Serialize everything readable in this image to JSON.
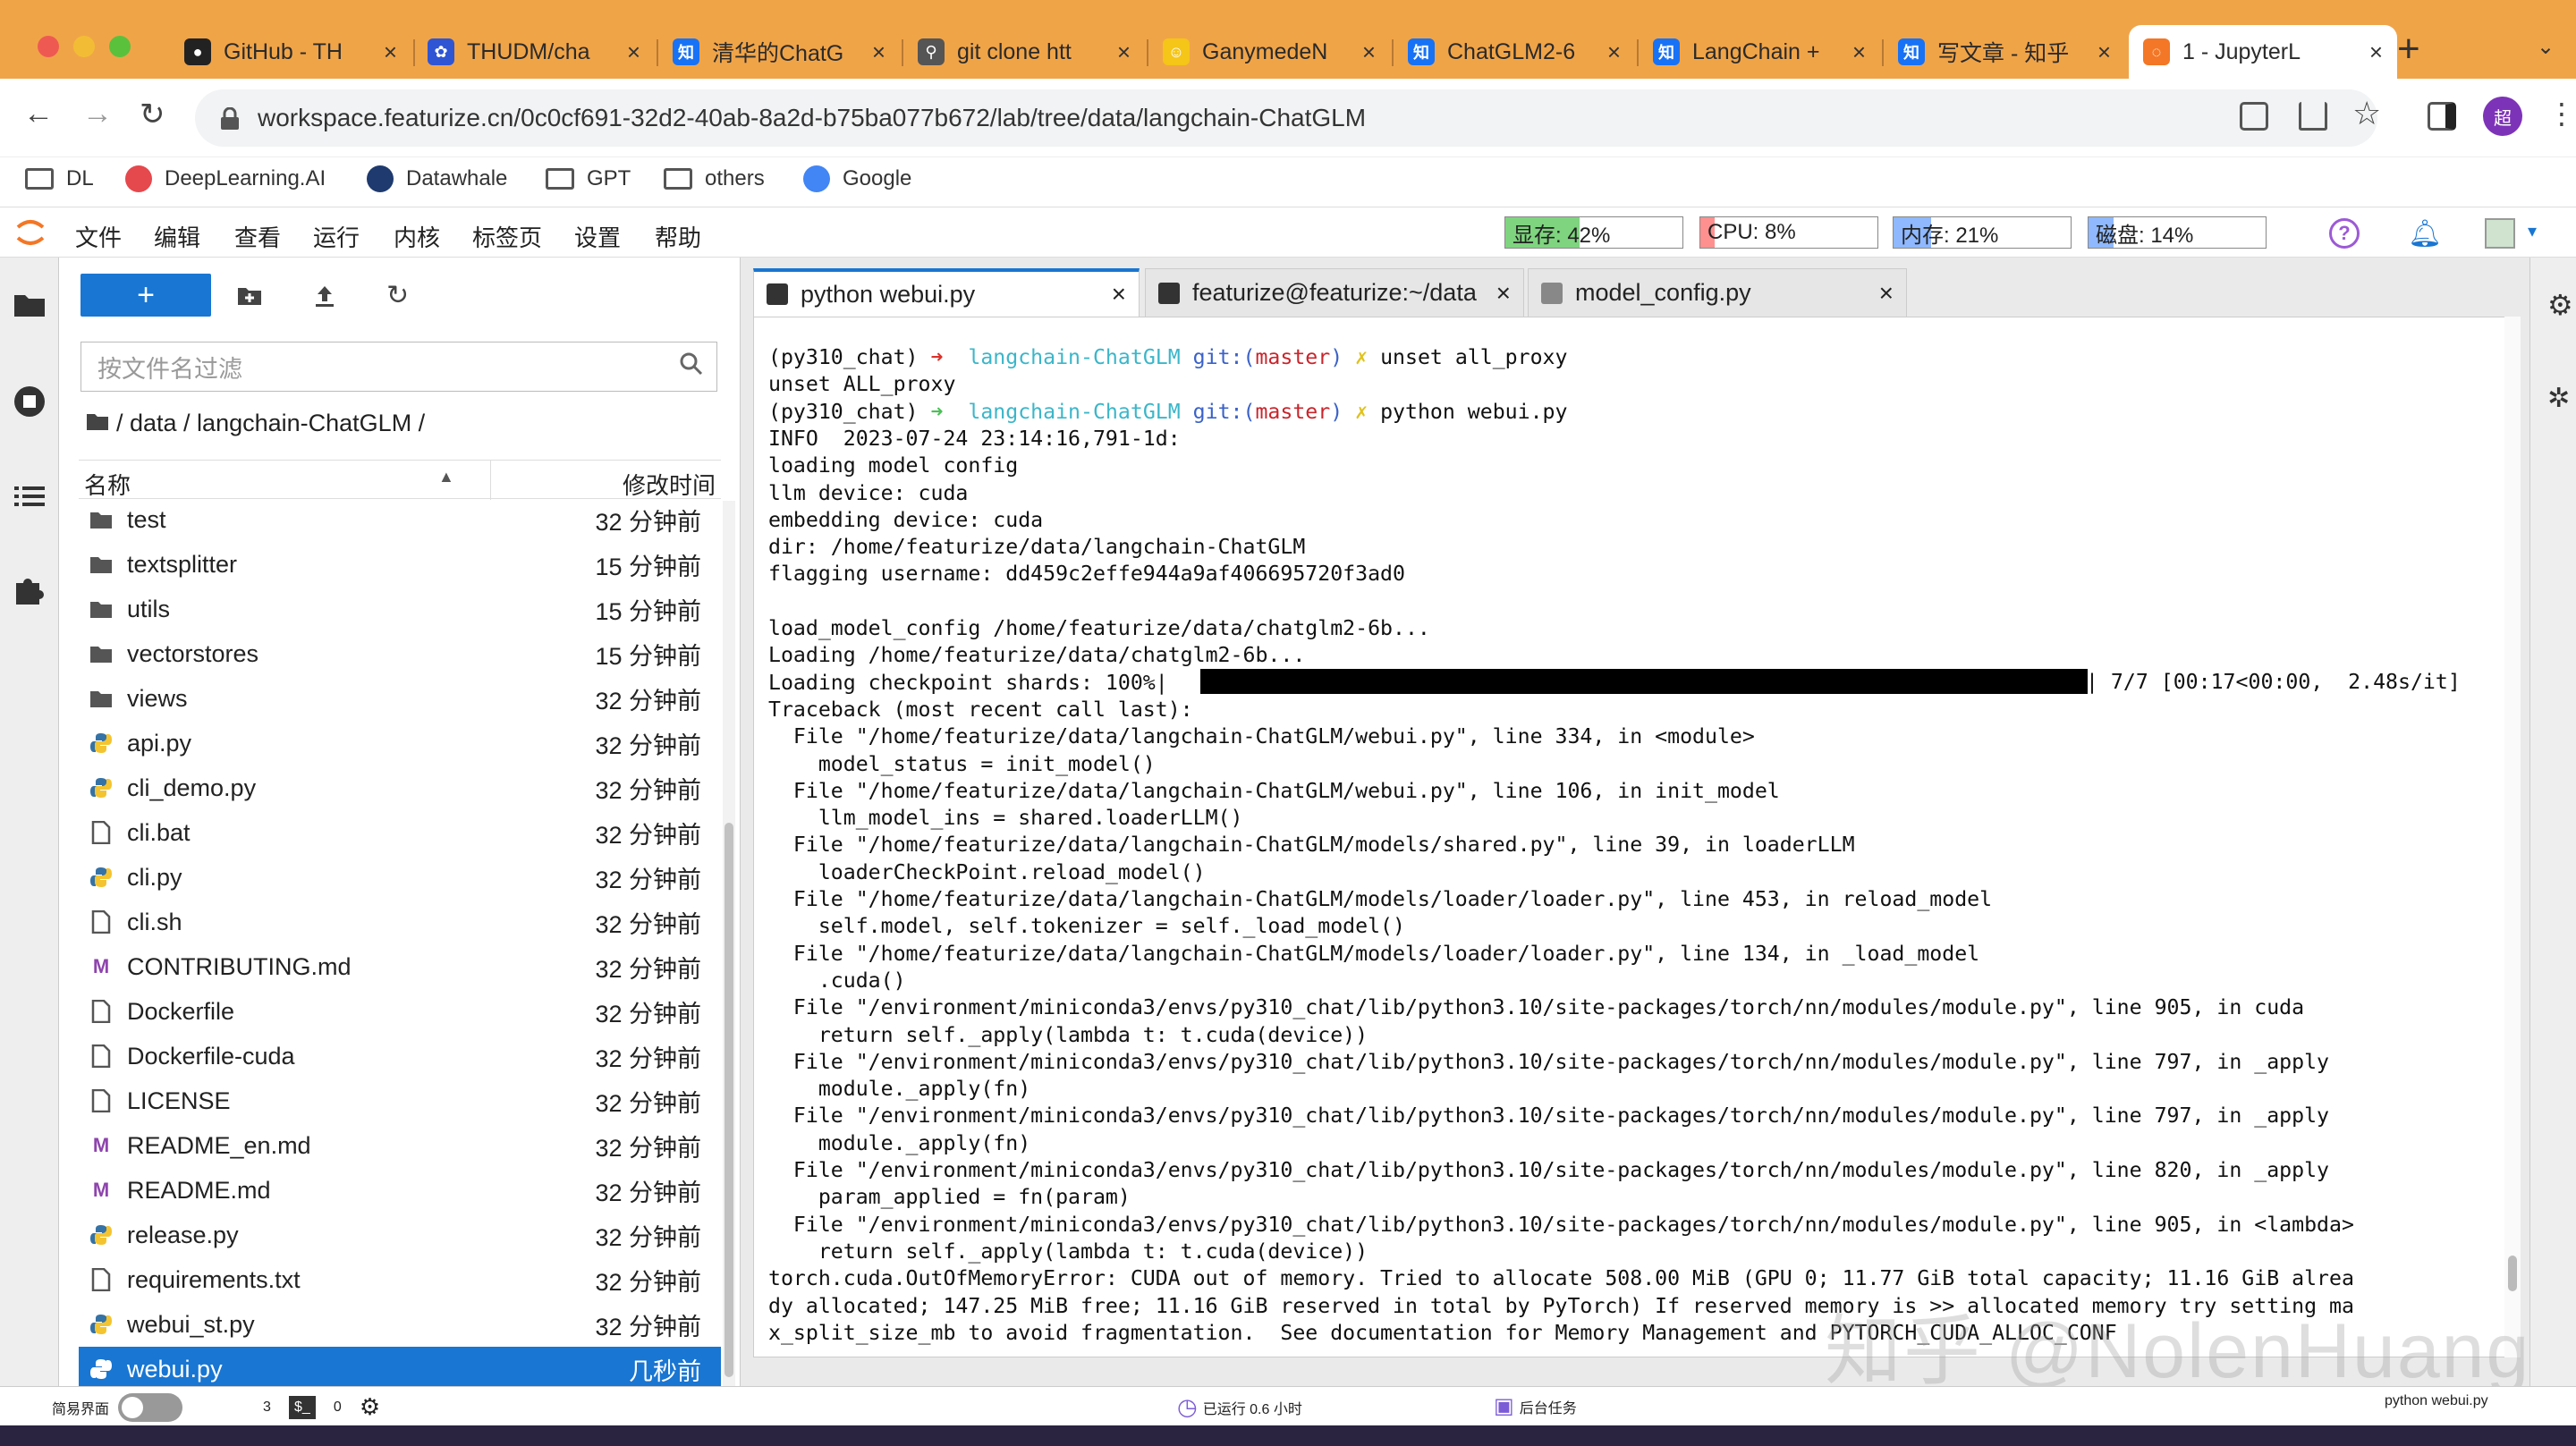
{
  "browser": {
    "tabs": [
      {
        "label": "GitHub - TH",
        "icon": "github-icon"
      },
      {
        "label": "THUDM/cha",
        "icon": "baidu-paw-icon"
      },
      {
        "label": "清华的ChatG",
        "icon": "zhihu-icon"
      },
      {
        "label": "git clone htt",
        "icon": "search-icon"
      },
      {
        "label": "GanymedeN",
        "icon": "emoji-icon"
      },
      {
        "label": "ChatGLM2-6",
        "icon": "zhihu-icon"
      },
      {
        "label": "LangChain +",
        "icon": "zhihu-icon"
      },
      {
        "label": "写文章 - 知乎",
        "icon": "zhihu-icon"
      },
      {
        "label": "1 - JupyterL",
        "icon": "jupyter-icon"
      }
    ],
    "url": "workspace.featurize.cn/0c0cf691-32d2-40ab-8a2d-b75ba077b672/lab/tree/data/langchain-ChatGLM",
    "avatar_text": "超",
    "bookmarks": [
      {
        "label": "DL",
        "icon": "folder-icon"
      },
      {
        "label": "DeepLearning.AI",
        "icon": "deeplearning-icon"
      },
      {
        "label": "Datawhale",
        "icon": "datawhale-icon"
      },
      {
        "label": "GPT",
        "icon": "folder-icon"
      },
      {
        "label": "others",
        "icon": "folder-icon"
      },
      {
        "label": "Google",
        "icon": "google-icon"
      }
    ]
  },
  "jupyter": {
    "menu": [
      "文件",
      "编辑",
      "查看",
      "运行",
      "内核",
      "标签页",
      "设置",
      "帮助"
    ],
    "meters": [
      {
        "label": "显存: 42%",
        "value": 0.42,
        "color": "#7fd47f"
      },
      {
        "label": "CPU: 8%",
        "value": 0.08,
        "color": "#ff9090"
      },
      {
        "label": "内存: 21%",
        "value": 0.21,
        "color": "#8fb8ff"
      },
      {
        "label": "磁盘: 14%",
        "value": 0.14,
        "color": "#8fb8ff"
      }
    ],
    "filebrowser": {
      "new_label": "+",
      "filter_placeholder": "按文件名过滤",
      "breadcrumb": "/ data / langchain-ChatGLM /",
      "col_name": "名称",
      "col_modified": "修改时间",
      "files": [
        {
          "name": "test",
          "type": "folder",
          "modified": "32 分钟前"
        },
        {
          "name": "textsplitter",
          "type": "folder",
          "modified": "15 分钟前"
        },
        {
          "name": "utils",
          "type": "folder",
          "modified": "15 分钟前"
        },
        {
          "name": "vectorstores",
          "type": "folder",
          "modified": "15 分钟前"
        },
        {
          "name": "views",
          "type": "folder",
          "modified": "32 分钟前"
        },
        {
          "name": "api.py",
          "type": "python",
          "modified": "32 分钟前"
        },
        {
          "name": "cli_demo.py",
          "type": "python",
          "modified": "32 分钟前"
        },
        {
          "name": "cli.bat",
          "type": "file",
          "modified": "32 分钟前"
        },
        {
          "name": "cli.py",
          "type": "python",
          "modified": "32 分钟前"
        },
        {
          "name": "cli.sh",
          "type": "file",
          "modified": "32 分钟前"
        },
        {
          "name": "CONTRIBUTING.md",
          "type": "markdown",
          "modified": "32 分钟前"
        },
        {
          "name": "Dockerfile",
          "type": "file",
          "modified": "32 分钟前"
        },
        {
          "name": "Dockerfile-cuda",
          "type": "file",
          "modified": "32 分钟前"
        },
        {
          "name": "LICENSE",
          "type": "file",
          "modified": "32 分钟前"
        },
        {
          "name": "README_en.md",
          "type": "markdown",
          "modified": "32 分钟前"
        },
        {
          "name": "README.md",
          "type": "markdown",
          "modified": "32 分钟前"
        },
        {
          "name": "release.py",
          "type": "python",
          "modified": "32 分钟前"
        },
        {
          "name": "requirements.txt",
          "type": "file",
          "modified": "32 分钟前"
        },
        {
          "name": "webui_st.py",
          "type": "python",
          "modified": "32 分钟前"
        },
        {
          "name": "webui.py",
          "type": "python",
          "modified": "几秒前",
          "selected": true
        }
      ]
    },
    "doc_tabs": [
      {
        "label": "python webui.py",
        "active": true
      },
      {
        "label": "featurize@featurize:~/data",
        "active": false
      },
      {
        "label": "model_config.py",
        "active": false
      }
    ],
    "terminal": {
      "lines": [
        [
          {
            "t": "(py310_chat) ",
            "c": "#111"
          },
          {
            "t": "➜  ",
            "c": "#d9322b"
          },
          {
            "t": "langchain-ChatGLM ",
            "c": "#3bb6c9"
          },
          {
            "t": "git:(",
            "c": "#3b62c9"
          },
          {
            "t": "master",
            "c": "#c9252c"
          },
          {
            "t": ") ",
            "c": "#3b62c9"
          },
          {
            "t": "✗ ",
            "c": "#e0c21e"
          },
          {
            "t": "unset all_proxy",
            "c": "#111"
          }
        ],
        [
          {
            "t": "unset ALL_proxy",
            "c": "#111"
          }
        ],
        [
          {
            "t": "(py310_chat) ",
            "c": "#111"
          },
          {
            "t": "➜  ",
            "c": "#4bbf57"
          },
          {
            "t": "langchain-ChatGLM ",
            "c": "#3bb6c9"
          },
          {
            "t": "git:(",
            "c": "#3b62c9"
          },
          {
            "t": "master",
            "c": "#c9252c"
          },
          {
            "t": ") ",
            "c": "#3b62c9"
          },
          {
            "t": "✗ ",
            "c": "#e0c21e"
          },
          {
            "t": "python webui.py",
            "c": "#111"
          }
        ],
        [
          {
            "t": "INFO  2023-07-24 23:14:16,791-1d:",
            "c": "#111"
          }
        ],
        [
          {
            "t": "loading model config",
            "c": "#111"
          }
        ],
        [
          {
            "t": "llm device: cuda",
            "c": "#111"
          }
        ],
        [
          {
            "t": "embedding device: cuda",
            "c": "#111"
          }
        ],
        [
          {
            "t": "dir: /home/featurize/data/langchain-ChatGLM",
            "c": "#111"
          }
        ],
        [
          {
            "t": "flagging username: dd459c2effe944a9af406695720f3ad0",
            "c": "#111"
          }
        ],
        [
          {
            "t": "",
            "c": "#111"
          }
        ],
        [
          {
            "t": "load_model_config /home/featurize/data/chatglm2-6b...",
            "c": "#111"
          }
        ],
        [
          {
            "t": "Loading /home/featurize/data/chatglm2-6b...",
            "c": "#111"
          }
        ],
        [
          {
            "t": "Loading checkpoint shards: 100%|",
            "c": "#111"
          }
        ],
        [
          {
            "t": "Traceback (most recent call last):",
            "c": "#111"
          }
        ],
        [
          {
            "t": "  File \"/home/featurize/data/langchain-ChatGLM/webui.py\", line 334, in <module>",
            "c": "#111"
          }
        ],
        [
          {
            "t": "    model_status = init_model()",
            "c": "#111"
          }
        ],
        [
          {
            "t": "  File \"/home/featurize/data/langchain-ChatGLM/webui.py\", line 106, in init_model",
            "c": "#111"
          }
        ],
        [
          {
            "t": "    llm_model_ins = shared.loaderLLM()",
            "c": "#111"
          }
        ],
        [
          {
            "t": "  File \"/home/featurize/data/langchain-ChatGLM/models/shared.py\", line 39, in loaderLLM",
            "c": "#111"
          }
        ],
        [
          {
            "t": "    loaderCheckPoint.reload_model()",
            "c": "#111"
          }
        ],
        [
          {
            "t": "  File \"/home/featurize/data/langchain-ChatGLM/models/loader/loader.py\", line 453, in reload_model",
            "c": "#111"
          }
        ],
        [
          {
            "t": "    self.model, self.tokenizer = self._load_model()",
            "c": "#111"
          }
        ],
        [
          {
            "t": "  File \"/home/featurize/data/langchain-ChatGLM/models/loader/loader.py\", line 134, in _load_model",
            "c": "#111"
          }
        ],
        [
          {
            "t": "    .cuda()",
            "c": "#111"
          }
        ],
        [
          {
            "t": "  File \"/environment/miniconda3/envs/py310_chat/lib/python3.10/site-packages/torch/nn/modules/module.py\", line 905, in cuda",
            "c": "#111"
          }
        ],
        [
          {
            "t": "    return self._apply(lambda t: t.cuda(device))",
            "c": "#111"
          }
        ],
        [
          {
            "t": "  File \"/environment/miniconda3/envs/py310_chat/lib/python3.10/site-packages/torch/nn/modules/module.py\", line 797, in _apply",
            "c": "#111"
          }
        ],
        [
          {
            "t": "    module._apply(fn)",
            "c": "#111"
          }
        ],
        [
          {
            "t": "  File \"/environment/miniconda3/envs/py310_chat/lib/python3.10/site-packages/torch/nn/modules/module.py\", line 797, in _apply",
            "c": "#111"
          }
        ],
        [
          {
            "t": "    module._apply(fn)",
            "c": "#111"
          }
        ],
        [
          {
            "t": "  File \"/environment/miniconda3/envs/py310_chat/lib/python3.10/site-packages/torch/nn/modules/module.py\", line 820, in _apply",
            "c": "#111"
          }
        ],
        [
          {
            "t": "    param_applied = fn(param)",
            "c": "#111"
          }
        ],
        [
          {
            "t": "  File \"/environment/miniconda3/envs/py310_chat/lib/python3.10/site-packages/torch/nn/modules/module.py\", line 905, in <lambda>",
            "c": "#111"
          }
        ],
        [
          {
            "t": "    return self._apply(lambda t: t.cuda(device))",
            "c": "#111"
          }
        ],
        [
          {
            "t": "torch.cuda.OutOfMemoryError: CUDA out of memory. Tried to allocate 508.00 MiB (GPU 0; 11.77 GiB total capacity; 11.16 GiB alrea",
            "c": "#111"
          }
        ],
        [
          {
            "t": "dy allocated; 147.25 MiB free; 11.16 GiB reserved in total by PyTorch) If reserved memory is >> allocated memory try setting ma",
            "c": "#111"
          }
        ],
        [
          {
            "t": "x_split_size_mb to avoid fragmentation.  See documentation for Memory Management and PYTORCH_CUDA_ALLOC_CONF",
            "c": "#111"
          }
        ]
      ],
      "progress_tail": "| 7/7 [00:17<00:00,  2.48s/it]",
      "progress_value": 1.0
    },
    "status": {
      "simple_mode": "简易界面",
      "kernels": "3",
      "terminals": "0",
      "running": "已运行 0.6 小时",
      "background": "后台任务",
      "current": "python webui.py"
    }
  },
  "watermark": "知乎 @NolenHuang"
}
